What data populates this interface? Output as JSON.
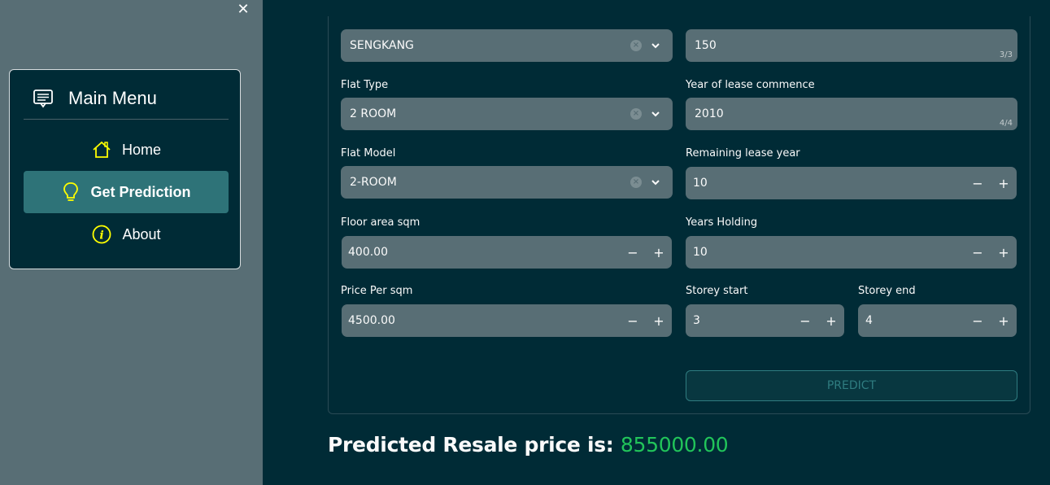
{
  "sidebar": {
    "close_symbol": "✕",
    "menu_title": "Main Menu",
    "menu_icon": "menu-card-icon",
    "items": [
      {
        "label": "Home",
        "icon": "home-icon",
        "active": false
      },
      {
        "label": "Get Prediction",
        "icon": "lightbulb-icon",
        "active": true
      },
      {
        "label": "About",
        "icon": "info-icon",
        "active": false
      }
    ],
    "accent_color": "#ffff00",
    "active_bg": "#2e7378"
  },
  "form": {
    "town": {
      "value": "SENGKANG"
    },
    "block": {
      "value": "150",
      "counter": "3/3"
    },
    "flat_type": {
      "label": "Flat Type",
      "value": "2 ROOM"
    },
    "lease_commence": {
      "label": "Year of lease commence",
      "value": "2010",
      "counter": "4/4"
    },
    "flat_model": {
      "label": "Flat Model",
      "value": "2-ROOM"
    },
    "remaining_lease": {
      "label": "Remaining lease year",
      "value": "10"
    },
    "floor_area": {
      "label": "Floor area sqm",
      "value": "400.00"
    },
    "years_holding": {
      "label": "Years Holding",
      "value": "10"
    },
    "price_per_sqm": {
      "label": "Price Per sqm",
      "value": "4500.00"
    },
    "storey_start": {
      "label": "Storey start",
      "value": "3"
    },
    "storey_end": {
      "label": "Storey end",
      "value": "4"
    },
    "minus_symbol": "−",
    "plus_symbol": "+",
    "clear_symbol": "×",
    "predict_label": "PREDICT"
  },
  "result": {
    "prefix": "Predicted Resale price is: ",
    "price": "855000.00",
    "price_color": "#21c45a"
  }
}
